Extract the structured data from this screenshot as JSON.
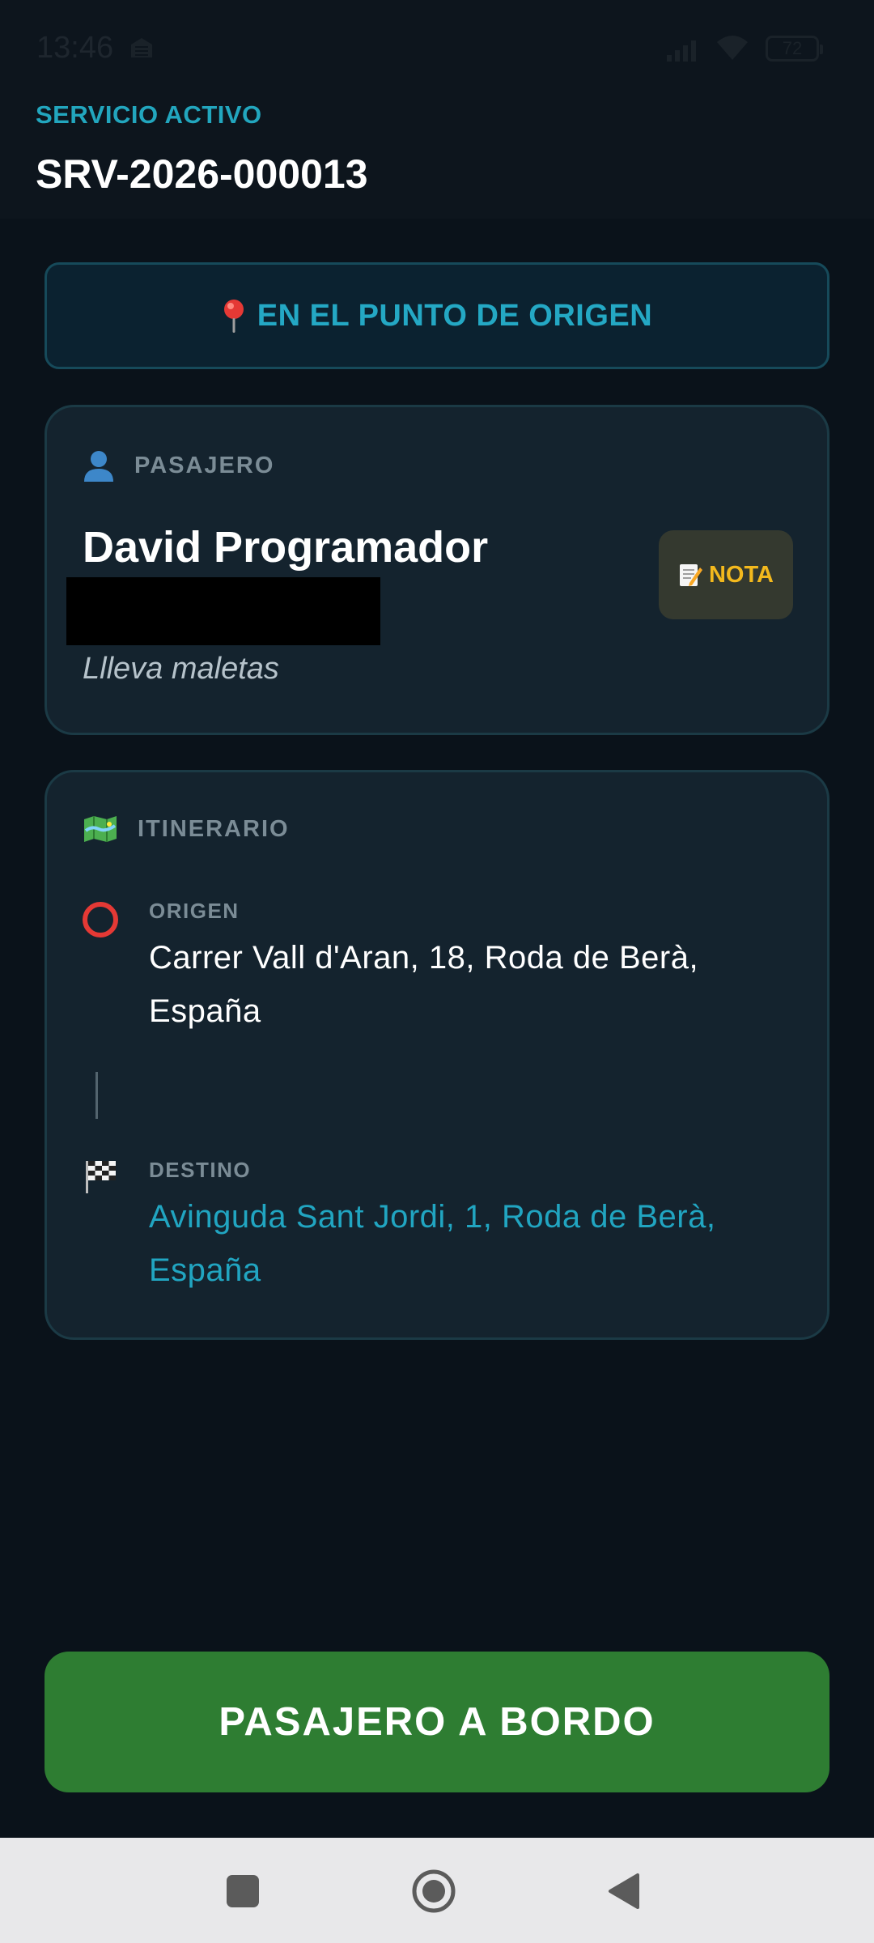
{
  "status_bar": {
    "time": "13:46",
    "battery": "72"
  },
  "header": {
    "eyebrow": "SERVICIO ACTIVO",
    "service_id": "SRV-2026-000013"
  },
  "status_banner": {
    "icon": "pin-icon",
    "label": "EN EL PUNTO DE ORIGEN"
  },
  "passenger": {
    "section_label": "PASAJERO",
    "icon": "person-icon",
    "name": "David Programador",
    "note_text": "Llleva maletas",
    "note_button_label": "NOTA"
  },
  "itinerary": {
    "section_label": "ITINERARIO",
    "icon": "map-icon",
    "origin": {
      "label": "ORIGEN",
      "address": "Carrer Vall d'Aran, 18, Roda de Berà, España"
    },
    "destination": {
      "label": "DESTINO",
      "address": "Avinguda Sant Jordi, 1, Roda de Berà, España"
    }
  },
  "primary_action": {
    "label": "PASAJERO A BORDO"
  },
  "colors": {
    "background": "#0a121a",
    "accent": "#22a6be",
    "card": "#14232e",
    "primary_button": "#2e7d32",
    "note_accent": "#f3b91d"
  }
}
